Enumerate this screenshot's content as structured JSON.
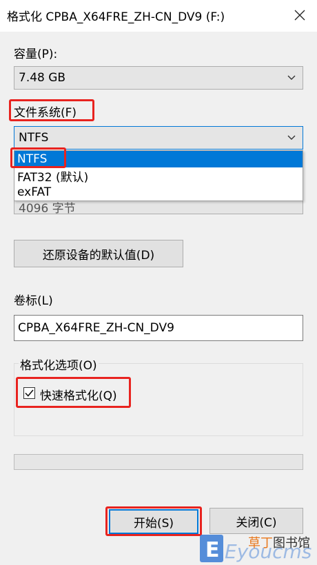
{
  "window": {
    "title": "格式化 CPBA_X64FRE_ZH-CN_DV9 (F:)"
  },
  "capacity": {
    "label": "容量(P):",
    "value": "7.48 GB"
  },
  "filesystem": {
    "label": "文件系统(F)",
    "value": "NTFS",
    "options": [
      "NTFS",
      "FAT32 (默认)",
      "exFAT"
    ],
    "selected_index": 0,
    "hidden_partial": "4096 字节"
  },
  "restore_button": {
    "label": "还原设备的默认值(D)"
  },
  "volume": {
    "label": "卷标(L)",
    "value": "CPBA_X64FRE_ZH-CN_DV9"
  },
  "format_options": {
    "label": "格式化选项(O)",
    "quick_format_label": "快速格式化(Q)",
    "quick_format_checked": true
  },
  "progress": {
    "fraction": 0
  },
  "buttons": {
    "start": "开始(S)",
    "close": "关闭(C)"
  },
  "watermark": {
    "logo_letters": "Eyoucms",
    "site_a": "草丁",
    "site_b": "图书馆"
  },
  "colors": {
    "accent": "#0078d7",
    "highlight_red": "#e8231f",
    "watermark_orange": "#e8761a",
    "watermark_blue": "#3a7bd5"
  }
}
